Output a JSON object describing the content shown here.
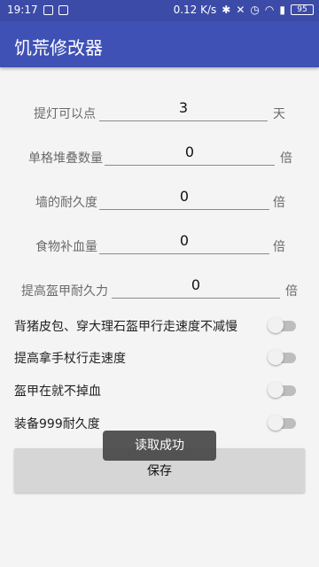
{
  "status_bar": {
    "time": "19:17",
    "network_speed": "0.12 K/s",
    "battery": "95"
  },
  "app": {
    "title": "饥荒修改器"
  },
  "fields": [
    {
      "label": "提灯可以点",
      "value": "3",
      "unit": "天"
    },
    {
      "label": "单格堆叠数量",
      "value": "0",
      "unit": "倍"
    },
    {
      "label": "墙的耐久度",
      "value": "0",
      "unit": "倍"
    },
    {
      "label": "食物补血量",
      "value": "0",
      "unit": "倍"
    },
    {
      "label": "提高盔甲耐久力",
      "value": "0",
      "unit": "倍"
    }
  ],
  "toggles": [
    {
      "label": "背猪皮包、穿大理石盔甲行走速度不减慢",
      "on": false
    },
    {
      "label": "提高拿手杖行走速度",
      "on": false
    },
    {
      "label": "盔甲在就不掉血",
      "on": false
    },
    {
      "label": "装备999耐久度",
      "on": false
    }
  ],
  "save_button": {
    "label": "保存"
  },
  "toast": {
    "text": "读取成功"
  }
}
